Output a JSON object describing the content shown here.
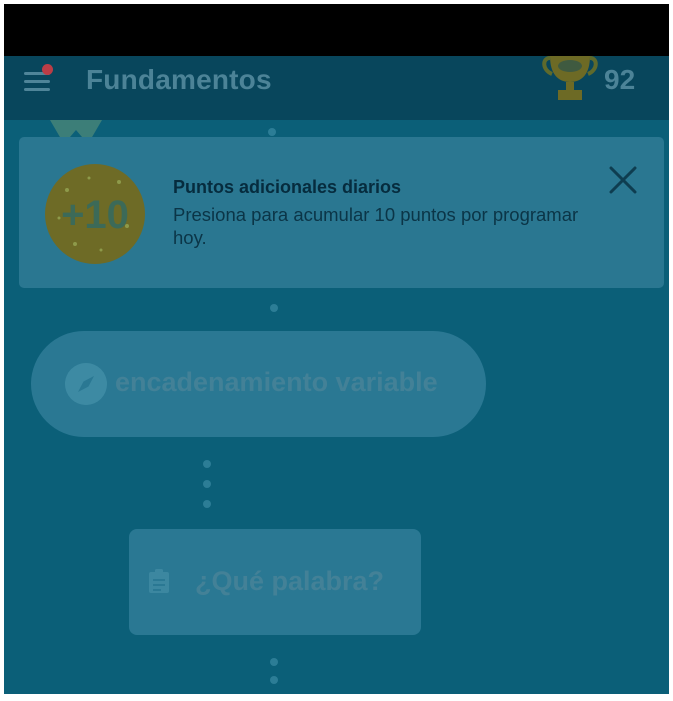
{
  "app_bar": {
    "title": "Fundamentos",
    "score": "92",
    "icons": [
      "menu-icon",
      "trophy-icon"
    ]
  },
  "banner": {
    "badge_text": "+10",
    "title": "Puntos adicionales diarios",
    "text": "Presiona para acumular 10 puntos por programar hoy.",
    "close_icon": "close-icon"
  },
  "lessons": [
    {
      "label": "encadenamiento variable",
      "icon": "compass-icon"
    },
    {
      "label": "¿Qué palabra?",
      "icon": "clipboard-icon"
    }
  ],
  "colors": {
    "background": "#0b5f78",
    "app_bar": "#08465c",
    "banner": "#2a7791",
    "node": "#2a7893",
    "badge": "#6e6b26",
    "notification_dot": "#bb3d46"
  }
}
